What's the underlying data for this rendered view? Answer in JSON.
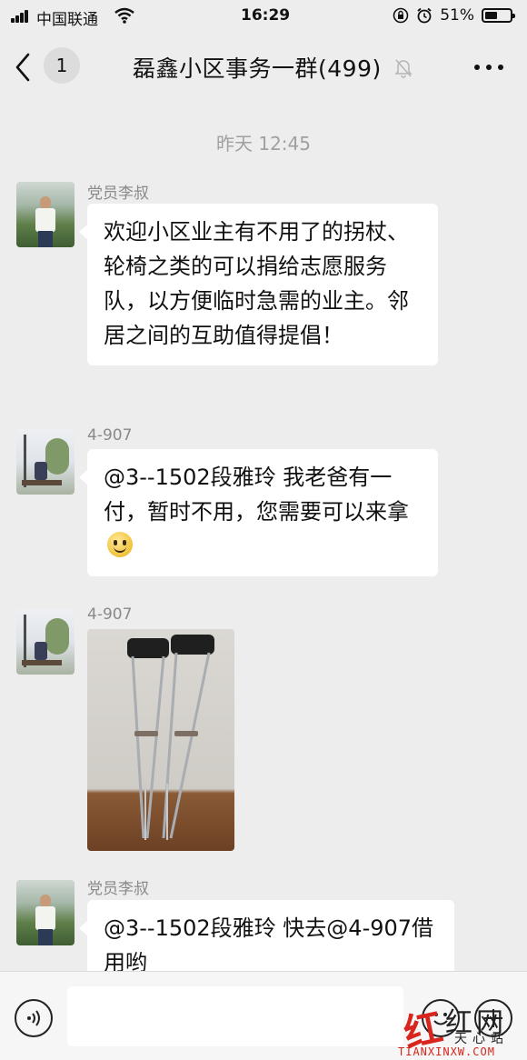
{
  "status_bar": {
    "carrier": "中国联通",
    "time": "16:29",
    "battery_percent": "51%",
    "battery_level": 0.51,
    "icons": [
      "signal-icon",
      "wifi-icon",
      "rotation-lock-icon",
      "alarm-icon",
      "battery-icon"
    ]
  },
  "nav": {
    "unread_count": "1",
    "title": "磊鑫小区事务一群(499)",
    "icons": [
      "back-chevron-icon",
      "mute-bell-icon",
      "more-icon"
    ]
  },
  "chat": {
    "timestamp": "昨天 12:45",
    "messages": [
      {
        "sender": "党员李叔",
        "avatar": "avatar-man-outdoors",
        "text": "欢迎小区业主有不用了的拐杖、轮椅之类的可以捐给志愿服务队，以方便临时急需的业主。邻居之间的互助值得提倡！"
      },
      {
        "sender": "4-907",
        "avatar": "avatar-garden",
        "text": "@3--1502段雅玲 我老爸有一付，暂时不用，您需要可以来拿",
        "emoji": "smile-emoji"
      },
      {
        "sender": "4-907",
        "avatar": "avatar-garden",
        "image": "crutches-photo"
      },
      {
        "sender": "党员李叔",
        "avatar": "avatar-man-outdoors",
        "text": "@3--1502段雅玲 快去@4-907借用哟"
      }
    ]
  },
  "input_bar": {
    "icons": [
      "voice-icon",
      "emoji-icon",
      "plus-icon"
    ]
  },
  "watermark": {
    "mark": "红",
    "name": "红网",
    "sub": "天心站",
    "domain": "TIANXINXW.COM"
  }
}
